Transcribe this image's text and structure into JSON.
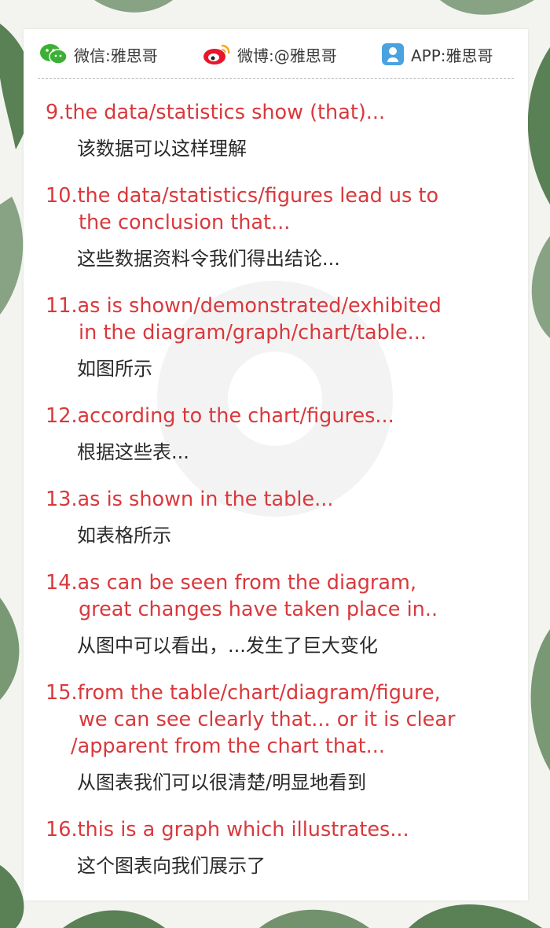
{
  "header": {
    "wechat_label": "微信:雅思哥",
    "weibo_label": "微博:@雅思哥",
    "app_label": "APP:雅思哥"
  },
  "entries": [
    {
      "en": [
        "9.the data/statistics show (that)..."
      ],
      "zh": "该数据可以这样理解"
    },
    {
      "en": [
        "10.the data/statistics/figures lead us to",
        "the conclusion that..."
      ],
      "zh": "这些数据资料令我们得出结论..."
    },
    {
      "en": [
        "11.as is shown/demonstrated/exhibited",
        "in the diagram/graph/chart/table..."
      ],
      "zh": "如图所示"
    },
    {
      "en": [
        "12.according to the chart/figures..."
      ],
      "zh": "根据这些表..."
    },
    {
      "en": [
        "13.as is shown in the table..."
      ],
      "zh": "如表格所示"
    },
    {
      "en": [
        "14.as can be seen from the diagram,",
        "great changes have taken place in.."
      ],
      "zh": "从图中可以看出，...发生了巨大变化"
    },
    {
      "en": [
        "15.from the table/chart/diagram/figure,",
        "we can see clearly that... or it is clear",
        "/apparent from the chart that..."
      ],
      "zh": "从图表我们可以很清楚/明显地看到"
    },
    {
      "en": [
        "16.this is a graph which illustrates..."
      ],
      "zh": "这个图表向我们展示了"
    }
  ],
  "colors": {
    "english_text": "#d9383c",
    "chinese_text": "#2a2a2a",
    "wechat_green": "#3cb034",
    "weibo_red": "#e6162d",
    "app_blue": "#4aa3df"
  }
}
